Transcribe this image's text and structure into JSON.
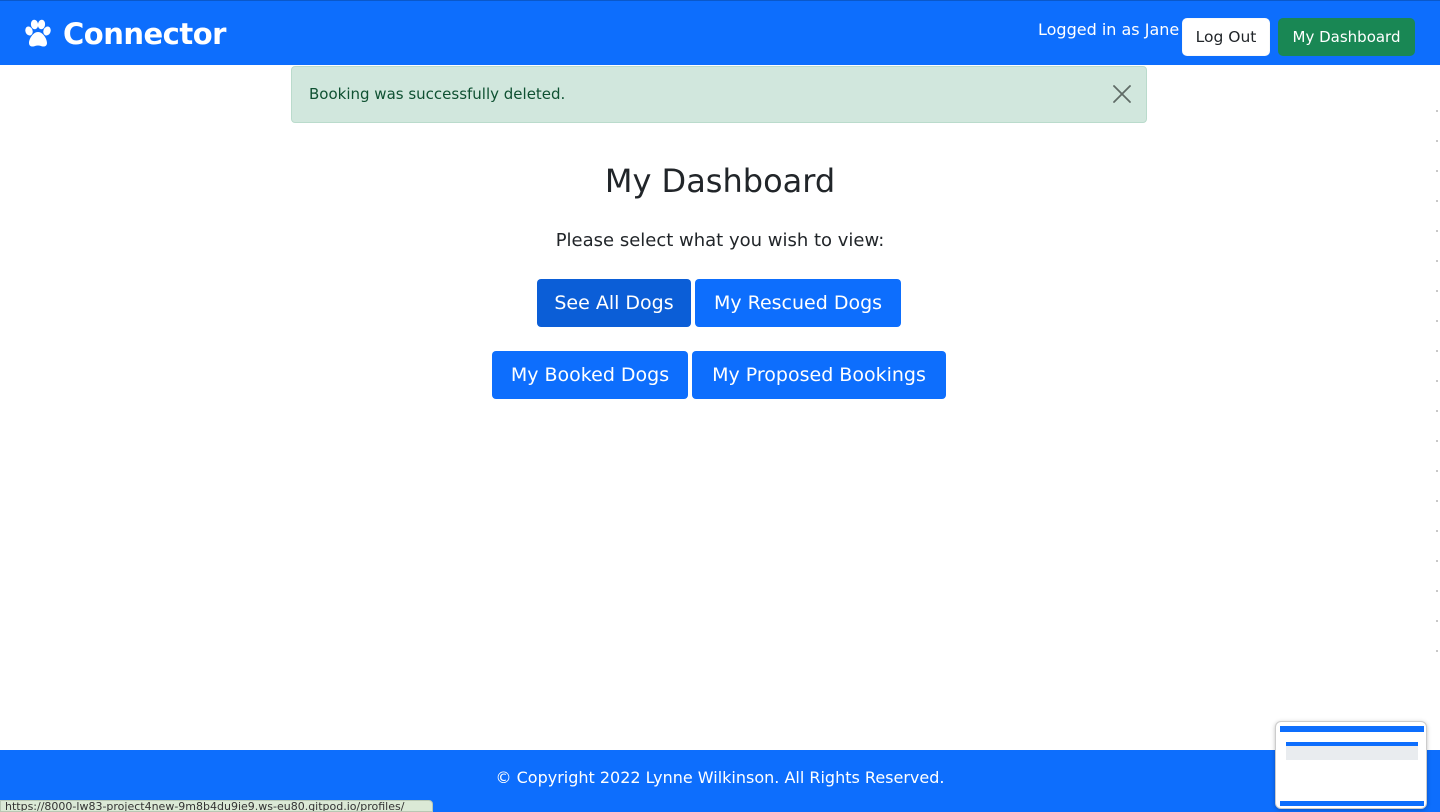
{
  "header": {
    "brand": "Connector",
    "brand_icon": "paw-icon",
    "user_status": "Logged in as Jane",
    "logout_label": "Log Out",
    "dashboard_label": "My Dashboard",
    "colors": {
      "primary": "#0d6efd",
      "success": "#198754"
    }
  },
  "alert": {
    "message": "Booking was successfully deleted.",
    "close_icon": "close-icon",
    "colors": {
      "background": "#d1e7dd",
      "text": "#0f5132"
    }
  },
  "main": {
    "title": "My Dashboard",
    "subtitle": "Please select what you wish to view:",
    "buttons": [
      {
        "label": "See All Dogs",
        "active": true
      },
      {
        "label": "My Rescued Dogs",
        "active": false
      },
      {
        "label": "My Booked Dogs",
        "active": false
      },
      {
        "label": "My Proposed Bookings",
        "active": false
      }
    ]
  },
  "footer": {
    "text": "© Copyright 2022 Lynne Wilkinson. All Rights Reserved."
  },
  "browser": {
    "status_url": "https://8000-lw83-project4new-9m8b4du9ie9.ws-eu80.gitpod.io/profiles/"
  }
}
